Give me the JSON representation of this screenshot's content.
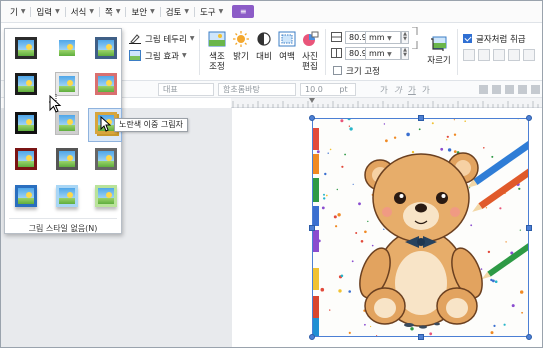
{
  "menubar": {
    "items": [
      {
        "label": "기"
      },
      {
        "label": "입력"
      },
      {
        "label": "서식"
      },
      {
        "label": "쪽"
      },
      {
        "label": "보안"
      },
      {
        "label": "검토"
      },
      {
        "label": "도구"
      }
    ],
    "accent_label": "≡",
    "accent_color": "#8c5cc7"
  },
  "ribbon": {
    "border_label": "그림 테두리",
    "effect_label": "그림 효과",
    "color_adjust_label": "색조\n조정",
    "brightness_label": "밝기",
    "contrast_label": "대비",
    "margin_label": "여백",
    "photo_edit_label": "사진\n편집",
    "width_value": "80.96",
    "height_value": "80.95",
    "unit": "mm",
    "lock_size_label": "크기 고정",
    "crop_label": "자르기",
    "text_wrap_label": "글자처럼 취급",
    "text_wrap_checked": true
  },
  "format_toolbar": {
    "style_placeholder": "대표",
    "font_placeholder": "함초롬바탕",
    "size_value": "10.0",
    "size_unit": "pt",
    "glyphs": [
      "가",
      "가",
      "가",
      "가"
    ]
  },
  "gallery": {
    "footer_label": "그림 스타일 없음(N)",
    "tooltip": "노란색 이중 그림자",
    "items": [
      {
        "name": "style-1",
        "frame": "#2b2b2b"
      },
      {
        "name": "style-2",
        "frame": "#ffffff"
      },
      {
        "name": "style-3",
        "frame": "#3f5f86"
      },
      {
        "name": "style-4",
        "frame": "#1b1b1b"
      },
      {
        "name": "style-5",
        "frame": "#e8e8e8"
      },
      {
        "name": "style-6",
        "frame": "#d97070"
      },
      {
        "name": "style-7",
        "frame": "#111111"
      },
      {
        "name": "style-8",
        "frame": "#cfcfcf"
      },
      {
        "name": "style-9",
        "frame": "#d7a63e"
      },
      {
        "name": "style-10",
        "frame": "#7a1414"
      },
      {
        "name": "style-11",
        "frame": "#555555"
      },
      {
        "name": "style-12",
        "frame": "#666666"
      },
      {
        "name": "style-13",
        "frame": "#2a6fbf"
      },
      {
        "name": "style-14",
        "frame": "#a9d6f5"
      },
      {
        "name": "style-15",
        "frame": "#b9e39a"
      }
    ]
  },
  "selection_color": "#4c7fd4"
}
